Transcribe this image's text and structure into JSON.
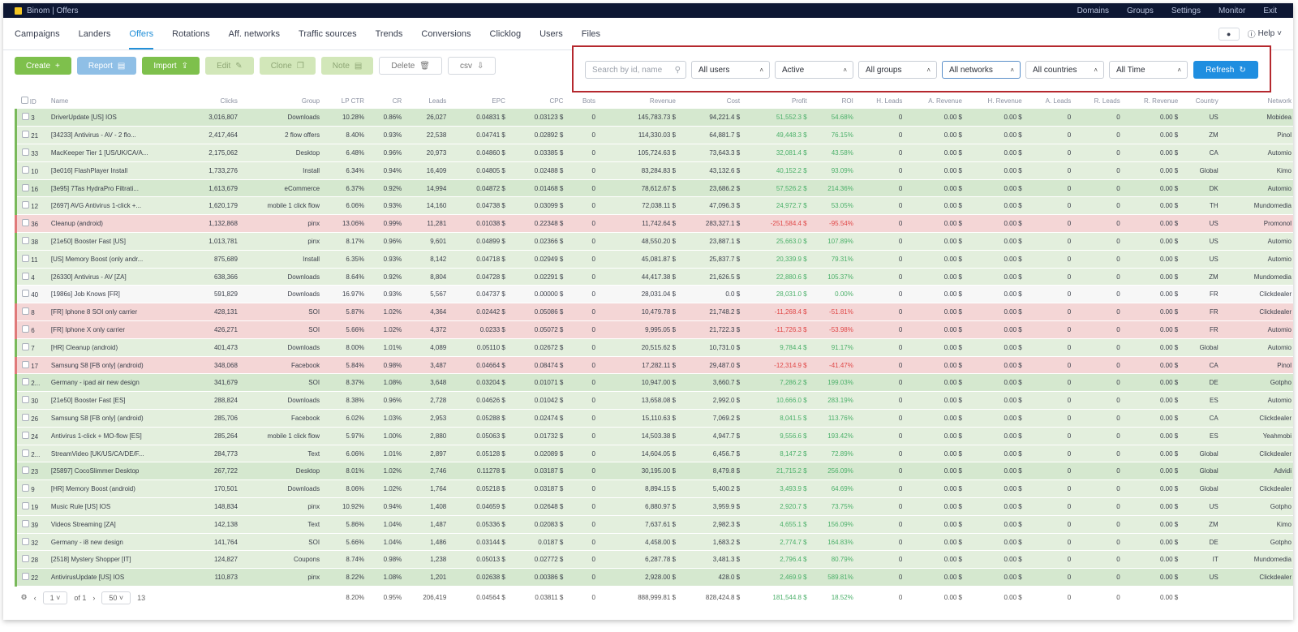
{
  "topbar": {
    "brand": "Binom | Offers",
    "links": [
      "Domains",
      "Groups",
      "Settings",
      "Monitor",
      "Exit"
    ]
  },
  "nav": {
    "tabs": [
      "Campaigns",
      "Landers",
      "Offers",
      "Rotations",
      "Aff. networks",
      "Traffic sources",
      "Trends",
      "Conversions",
      "Clicklog",
      "Users",
      "Files"
    ],
    "active": "Offers",
    "help": "Help"
  },
  "toolbar": {
    "create": "Create",
    "report": "Report",
    "import": "Import",
    "edit": "Edit",
    "clone": "Clone",
    "note": "Note",
    "delete": "Delete",
    "csv": "csv"
  },
  "filters": {
    "search_placeholder": "Search by id, name",
    "users": "All users",
    "status": "Active",
    "groups": "All groups",
    "networks": "All networks",
    "countries": "All countries",
    "time": "All Time",
    "refresh": "Refresh"
  },
  "table": {
    "headers": [
      "ID",
      "Name",
      "Clicks",
      "Group",
      "LP CTR",
      "CR",
      "Leads",
      "EPC",
      "CPC",
      "Bots",
      "Revenue",
      "Cost",
      "Profit",
      "ROI",
      "H. Leads",
      "A. Revenue",
      "H. Revenue",
      "A. Leads",
      "R. Leads",
      "R. Revenue",
      "Country",
      "Network"
    ],
    "rows": [
      [
        "3",
        "DriverUpdate [US] IOS",
        "3,016,807",
        "Downloads",
        "10.28%",
        "0.86%",
        "26,027",
        "0.04831 $",
        "0.03123 $",
        "0",
        "145,783.73 $",
        "94,221.4 $",
        "51,552.3 $",
        "54.68%",
        "0",
        "0.00 $",
        "0.00 $",
        "0",
        "0",
        "0.00 $",
        "US",
        "Mobidea"
      ],
      [
        "21",
        "[34233] Antivirus - AV - 2 flo...",
        "2,417,464",
        "2 flow offers",
        "8.40%",
        "0.93%",
        "22,538",
        "0.04741 $",
        "0.02892 $",
        "0",
        "114,330.03 $",
        "64,881.7 $",
        "49,448.3 $",
        "76.15%",
        "0",
        "0.00 $",
        "0.00 $",
        "0",
        "0",
        "0.00 $",
        "ZM",
        "Pinol"
      ],
      [
        "33",
        "MacKeeper Tier 1 [US/UK/CA/A...",
        "2,175,062",
        "Desktop",
        "6.48%",
        "0.96%",
        "20,973",
        "0.04860 $",
        "0.03385 $",
        "0",
        "105,724.63 $",
        "73,643.3 $",
        "32,081.4 $",
        "43.58%",
        "0",
        "0.00 $",
        "0.00 $",
        "0",
        "0",
        "0.00 $",
        "CA",
        "Automio"
      ],
      [
        "10",
        "[3e016] FlashPlayer Install",
        "1,733,276",
        "Install",
        "6.34%",
        "0.94%",
        "16,409",
        "0.04805 $",
        "0.02488 $",
        "0",
        "83,284.83 $",
        "43,132.6 $",
        "40,152.2 $",
        "93.09%",
        "0",
        "0.00 $",
        "0.00 $",
        "0",
        "0",
        "0.00 $",
        "Global",
        "Kimo"
      ],
      [
        "16",
        "[3e95] 7Tas HydraPro Filtrati...",
        "1,613,679",
        "eCommerce",
        "6.37%",
        "0.92%",
        "14,994",
        "0.04872 $",
        "0.01468 $",
        "0",
        "78,612.67 $",
        "23,686.2 $",
        "57,526.2 $",
        "214.36%",
        "0",
        "0.00 $",
        "0.00 $",
        "0",
        "0",
        "0.00 $",
        "DK",
        "Automio"
      ],
      [
        "12",
        "[2697] AVG Antivirus 1-click +...",
        "1,620,179",
        "mobile 1 click flow",
        "6.06%",
        "0.93%",
        "14,160",
        "0.04738 $",
        "0.03099 $",
        "0",
        "72,038.11 $",
        "47,096.3 $",
        "24,972.7 $",
        "53.05%",
        "0",
        "0.00 $",
        "0.00 $",
        "0",
        "0",
        "0.00 $",
        "TH",
        "Mundomedia"
      ],
      [
        "36",
        "Cleanup (android)",
        "1,132,868",
        "pinx",
        "13.06%",
        "0.99%",
        "11,281",
        "0.01038 $",
        "0.22348 $",
        "0",
        "11,742.64 $",
        "283,327.1 $",
        "-251,584.4 $",
        "-95.54%",
        "0",
        "0.00 $",
        "0.00 $",
        "0",
        "0",
        "0.00 $",
        "US",
        "Promonol"
      ],
      [
        "38",
        "[21e50] Booster Fast [US]",
        "1,013,781",
        "pinx",
        "8.17%",
        "0.96%",
        "9,601",
        "0.04899 $",
        "0.02366 $",
        "0",
        "48,550.20 $",
        "23,887.1 $",
        "25,663.0 $",
        "107.89%",
        "0",
        "0.00 $",
        "0.00 $",
        "0",
        "0",
        "0.00 $",
        "US",
        "Automio"
      ],
      [
        "11",
        "[US] Memory Boost (only andr...",
        "875,689",
        "Install",
        "6.35%",
        "0.93%",
        "8,142",
        "0.04718 $",
        "0.02949 $",
        "0",
        "45,081.87 $",
        "25,837.7 $",
        "20,339.9 $",
        "79.31%",
        "0",
        "0.00 $",
        "0.00 $",
        "0",
        "0",
        "0.00 $",
        "US",
        "Automio"
      ],
      [
        "4",
        "[26330] Antivirus - AV [ZA]",
        "638,366",
        "Downloads",
        "8.64%",
        "0.92%",
        "8,804",
        "0.04728 $",
        "0.02291 $",
        "0",
        "44,417.38 $",
        "21,626.5 $",
        "22,880.6 $",
        "105.37%",
        "0",
        "0.00 $",
        "0.00 $",
        "0",
        "0",
        "0.00 $",
        "ZM",
        "Mundomedia"
      ],
      [
        "40",
        "[1986s] Job Knows [FR]",
        "591,829",
        "Downloads",
        "16.97%",
        "0.93%",
        "5,567",
        "0.04737 $",
        "0.00000 $",
        "0",
        "28,031.04 $",
        "0.0 $",
        "28,031.0 $",
        "0.00%",
        "0",
        "0.00 $",
        "0.00 $",
        "0",
        "0",
        "0.00 $",
        "FR",
        "Clickdealer"
      ],
      [
        "8",
        "[FR] Iphone 8 SOI only carrier",
        "428,131",
        "SOI",
        "5.87%",
        "1.02%",
        "4,364",
        "0.02442 $",
        "0.05086 $",
        "0",
        "10,479.78 $",
        "21,748.2 $",
        "-11,268.4 $",
        "-51.81%",
        "0",
        "0.00 $",
        "0.00 $",
        "0",
        "0",
        "0.00 $",
        "FR",
        "Clickdealer"
      ],
      [
        "6",
        "[FR] Iphone X only carrier",
        "426,271",
        "SOI",
        "5.66%",
        "1.02%",
        "4,372",
        "0.0233 $",
        "0.05072 $",
        "0",
        "9,995.05 $",
        "21,722.3 $",
        "-11,726.3 $",
        "-53.98%",
        "0",
        "0.00 $",
        "0.00 $",
        "0",
        "0",
        "0.00 $",
        "FR",
        "Automio"
      ],
      [
        "7",
        "[HR] Cleanup (android)",
        "401,473",
        "Downloads",
        "8.00%",
        "1.01%",
        "4,089",
        "0.05110 $",
        "0.02672 $",
        "0",
        "20,515.62 $",
        "10,731.0 $",
        "9,784.4 $",
        "91.17%",
        "0",
        "0.00 $",
        "0.00 $",
        "0",
        "0",
        "0.00 $",
        "Global",
        "Automio"
      ],
      [
        "17",
        "Samsung S8 [FB only] (android)",
        "348,068",
        "Facebook",
        "5.84%",
        "0.98%",
        "3,487",
        "0.04664 $",
        "0.08474 $",
        "0",
        "17,282.11 $",
        "29,487.0 $",
        "-12,314.9 $",
        "-41.47%",
        "0",
        "0.00 $",
        "0.00 $",
        "0",
        "0",
        "0.00 $",
        "CA",
        "Pinol"
      ],
      [
        "2...",
        "Germany - ipad air new design",
        "341,679",
        "SOI",
        "8.37%",
        "1.08%",
        "3,648",
        "0.03204 $",
        "0.01071 $",
        "0",
        "10,947.00 $",
        "3,660.7 $",
        "7,286.2 $",
        "199.03%",
        "0",
        "0.00 $",
        "0.00 $",
        "0",
        "0",
        "0.00 $",
        "DE",
        "Gotpho"
      ],
      [
        "30",
        "[21e50] Booster Fast [ES]",
        "288,824",
        "Downloads",
        "8.38%",
        "0.96%",
        "2,728",
        "0.04626 $",
        "0.01042 $",
        "0",
        "13,658.08 $",
        "2,992.0 $",
        "10,666.0 $",
        "283.19%",
        "0",
        "0.00 $",
        "0.00 $",
        "0",
        "0",
        "0.00 $",
        "ES",
        "Automio"
      ],
      [
        "26",
        "Samsung S8 [FB only] (android)",
        "285,706",
        "Facebook",
        "6.02%",
        "1.03%",
        "2,953",
        "0.05288 $",
        "0.02474 $",
        "0",
        "15,110.63 $",
        "7,069.2 $",
        "8,041.5 $",
        "113.76%",
        "0",
        "0.00 $",
        "0.00 $",
        "0",
        "0",
        "0.00 $",
        "CA",
        "Clickdealer"
      ],
      [
        "24",
        "Antivirus 1-click + MO-flow [ES]",
        "285,264",
        "mobile 1 click flow",
        "5.97%",
        "1.00%",
        "2,880",
        "0.05063 $",
        "0.01732 $",
        "0",
        "14,503.38 $",
        "4,947.7 $",
        "9,556.6 $",
        "193.42%",
        "0",
        "0.00 $",
        "0.00 $",
        "0",
        "0",
        "0.00 $",
        "ES",
        "Yeahmobi"
      ],
      [
        "2...",
        "StreamVideo [UK/US/CA/DE/F...",
        "284,773",
        "Text",
        "6.06%",
        "1.01%",
        "2,897",
        "0.05128 $",
        "0.02089 $",
        "0",
        "14,604.05 $",
        "6,456.7 $",
        "8,147.2 $",
        "72.89%",
        "0",
        "0.00 $",
        "0.00 $",
        "0",
        "0",
        "0.00 $",
        "Global",
        "Clickdealer"
      ],
      [
        "23",
        "[25897] CocoSlimmer Desktop",
        "267,722",
        "Desktop",
        "8.01%",
        "1.02%",
        "2,746",
        "0.11278 $",
        "0.03187 $",
        "0",
        "30,195.00 $",
        "8,479.8 $",
        "21,715.2 $",
        "256.09%",
        "0",
        "0.00 $",
        "0.00 $",
        "0",
        "0",
        "0.00 $",
        "Global",
        "Advidi"
      ],
      [
        "9",
        "[HR] Memory Boost (android)",
        "170,501",
        "Downloads",
        "8.06%",
        "1.02%",
        "1,764",
        "0.05218 $",
        "0.03187 $",
        "0",
        "8,894.15 $",
        "5,400.2 $",
        "3,493.9 $",
        "64.69%",
        "0",
        "0.00 $",
        "0.00 $",
        "0",
        "0",
        "0.00 $",
        "Global",
        "Clickdealer"
      ],
      [
        "19",
        "Music Rule [US] IOS",
        "148,834",
        "pinx",
        "10.92%",
        "0.94%",
        "1,408",
        "0.04659 $",
        "0.02648 $",
        "0",
        "6,880.97 $",
        "3,959.9 $",
        "2,920.7 $",
        "73.75%",
        "0",
        "0.00 $",
        "0.00 $",
        "0",
        "0",
        "0.00 $",
        "US",
        "Gotpho"
      ],
      [
        "39",
        "Videos Streaming [ZA]",
        "142,138",
        "Text",
        "5.86%",
        "1.04%",
        "1,487",
        "0.05336 $",
        "0.02083 $",
        "0",
        "7,637.61 $",
        "2,982.3 $",
        "4,655.1 $",
        "156.09%",
        "0",
        "0.00 $",
        "0.00 $",
        "0",
        "0",
        "0.00 $",
        "ZM",
        "Kimo"
      ],
      [
        "32",
        "Germany - i8 new design",
        "141,764",
        "SOI",
        "5.66%",
        "1.04%",
        "1,486",
        "0.03144 $",
        "0.0187 $",
        "0",
        "4,458.00 $",
        "1,683.2 $",
        "2,774.7 $",
        "164.83%",
        "0",
        "0.00 $",
        "0.00 $",
        "0",
        "0",
        "0.00 $",
        "DE",
        "Gotpho"
      ],
      [
        "28",
        "[2518] Mystery Shopper [IT]",
        "124,827",
        "Coupons",
        "8.74%",
        "0.98%",
        "1,238",
        "0.05013 $",
        "0.02772 $",
        "0",
        "6,287.78 $",
        "3,481.3 $",
        "2,796.4 $",
        "80.79%",
        "0",
        "0.00 $",
        "0.00 $",
        "0",
        "0",
        "0.00 $",
        "IT",
        "Mundomedia"
      ],
      [
        "22",
        "AntivirusUpdate [US] IOS",
        "110,873",
        "pinx",
        "8.22%",
        "1.08%",
        "1,201",
        "0.02638 $",
        "0.00386 $",
        "0",
        "2,928.00 $",
        "428.0 $",
        "2,469.9 $",
        "589.81%",
        "0",
        "0.00 $",
        "0.00 $",
        "0",
        "0",
        "0.00 $",
        "US",
        "Clickdealer"
      ]
    ],
    "row_styles": [
      "g",
      "g2",
      "g2",
      "g2",
      "g",
      "g2",
      "r",
      "g2",
      "g2",
      "g2",
      "w",
      "r",
      "r",
      "g2",
      "r",
      "g",
      "g2",
      "g2",
      "g2",
      "g2",
      "g",
      "g2",
      "g2",
      "g2",
      "g2",
      "g2",
      "g"
    ],
    "totals": {
      "page": "1",
      "of": "of 1",
      "per_page": "50",
      "count": "13",
      "lp_ctr": "8.20%",
      "cr": "0.95%",
      "leads": "206,419",
      "epc": "0.04564 $",
      "cpc": "0.03811 $",
      "bots": "0",
      "revenue": "888,999.81 $",
      "cost": "828,424.8 $",
      "profit": "181,544.8 $",
      "roi": "18.52%",
      "h_leads": "0",
      "a_revenue": "0.00 $",
      "h_revenue": "0.00 $",
      "a_leads": "0",
      "r_leads": "0",
      "r_revenue": "0.00 $"
    }
  },
  "colors": {
    "accent": "#1f8ee0",
    "highlight": "#b5282e",
    "positive": "#4cb06a",
    "negative": "#e04848"
  }
}
